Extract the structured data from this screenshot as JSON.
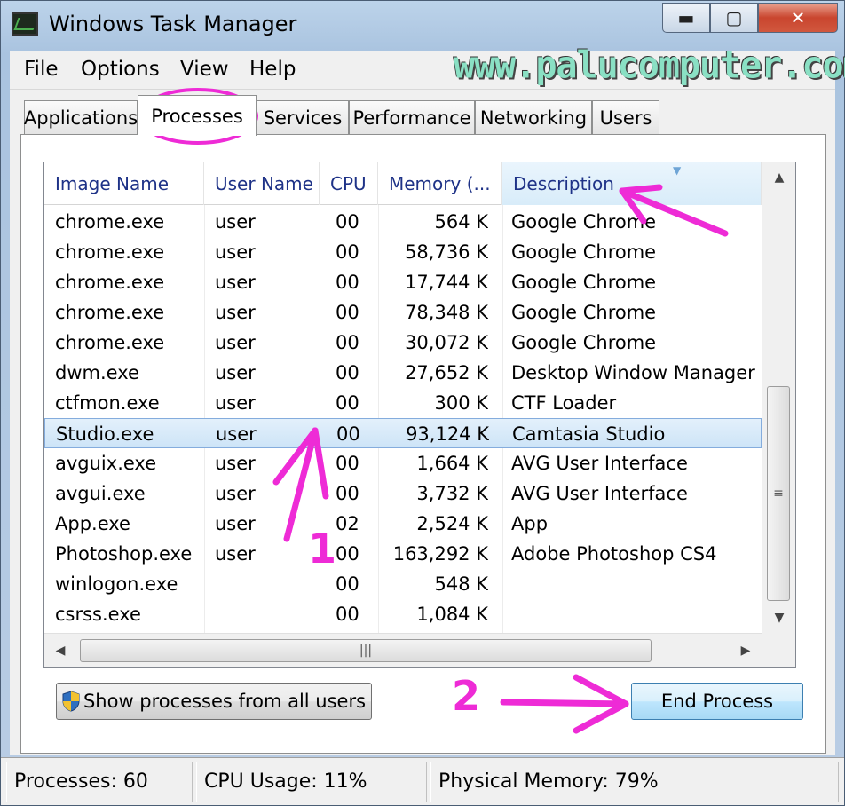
{
  "window": {
    "title": "Windows Task Manager"
  },
  "title_buttons": {
    "minimize": "▬",
    "maximize": "▢",
    "close": "✕"
  },
  "watermark": "www.palucomputer.com",
  "menu": [
    "File",
    "Options",
    "View",
    "Help"
  ],
  "tabs": [
    {
      "label": "Applications",
      "active": false
    },
    {
      "label": "Processes",
      "active": true
    },
    {
      "label": "Services",
      "active": false
    },
    {
      "label": "Performance",
      "active": false
    },
    {
      "label": "Networking",
      "active": false
    },
    {
      "label": "Users",
      "active": false
    }
  ],
  "process_table": {
    "columns": [
      "Image Name",
      "User Name",
      "CPU",
      "Memory (...",
      "Description"
    ],
    "sorted_column": "Description",
    "rows": [
      {
        "name": "chrome.exe",
        "user": "user",
        "cpu": "00",
        "mem": "564 K",
        "desc": "Google Chrome",
        "selected": false
      },
      {
        "name": "chrome.exe",
        "user": "user",
        "cpu": "00",
        "mem": "58,736 K",
        "desc": "Google Chrome",
        "selected": false
      },
      {
        "name": "chrome.exe",
        "user": "user",
        "cpu": "00",
        "mem": "17,744 K",
        "desc": "Google Chrome",
        "selected": false
      },
      {
        "name": "chrome.exe",
        "user": "user",
        "cpu": "00",
        "mem": "78,348 K",
        "desc": "Google Chrome",
        "selected": false
      },
      {
        "name": "chrome.exe",
        "user": "user",
        "cpu": "00",
        "mem": "30,072 K",
        "desc": "Google Chrome",
        "selected": false
      },
      {
        "name": "dwm.exe",
        "user": "user",
        "cpu": "00",
        "mem": "27,652 K",
        "desc": "Desktop Window Manager",
        "selected": false
      },
      {
        "name": "ctfmon.exe",
        "user": "user",
        "cpu": "00",
        "mem": "300 K",
        "desc": "CTF Loader",
        "selected": false
      },
      {
        "name": "Studio.exe",
        "user": "user",
        "cpu": "00",
        "mem": "93,124 K",
        "desc": "Camtasia Studio",
        "selected": true
      },
      {
        "name": "avguix.exe",
        "user": "user",
        "cpu": "00",
        "mem": "1,664 K",
        "desc": "AVG User Interface",
        "selected": false
      },
      {
        "name": "avgui.exe",
        "user": "user",
        "cpu": "00",
        "mem": "3,732 K",
        "desc": "AVG User Interface",
        "selected": false
      },
      {
        "name": "App.exe",
        "user": "user",
        "cpu": "02",
        "mem": "2,524 K",
        "desc": "App",
        "selected": false
      },
      {
        "name": "Photoshop.exe",
        "user": "user",
        "cpu": "00",
        "mem": "163,292 K",
        "desc": "Adobe Photoshop CS4",
        "selected": false
      },
      {
        "name": "winlogon.exe",
        "user": "",
        "cpu": "00",
        "mem": "548 K",
        "desc": "",
        "selected": false
      },
      {
        "name": "csrss.exe",
        "user": "",
        "cpu": "00",
        "mem": "1,084 K",
        "desc": "",
        "selected": false
      }
    ]
  },
  "buttons": {
    "show_all": "Show processes from all users",
    "end_process": "End Process"
  },
  "status_bar": {
    "processes": "Processes: 60",
    "cpu_usage": "CPU Usage: 11%",
    "physical_memory": "Physical Memory: 79%"
  },
  "annotations": {
    "step1": "1",
    "step2": "2",
    "color": "#ee2bd6"
  },
  "icons": {
    "app": "task-manager-icon",
    "shield": "uac-shield-icon",
    "sort": "sort-arrow-icon",
    "scroll_up": "▲",
    "scroll_down": "▼",
    "scroll_left": "◀",
    "scroll_right": "▶",
    "grip_v": "≡",
    "grip_h": "|||"
  }
}
